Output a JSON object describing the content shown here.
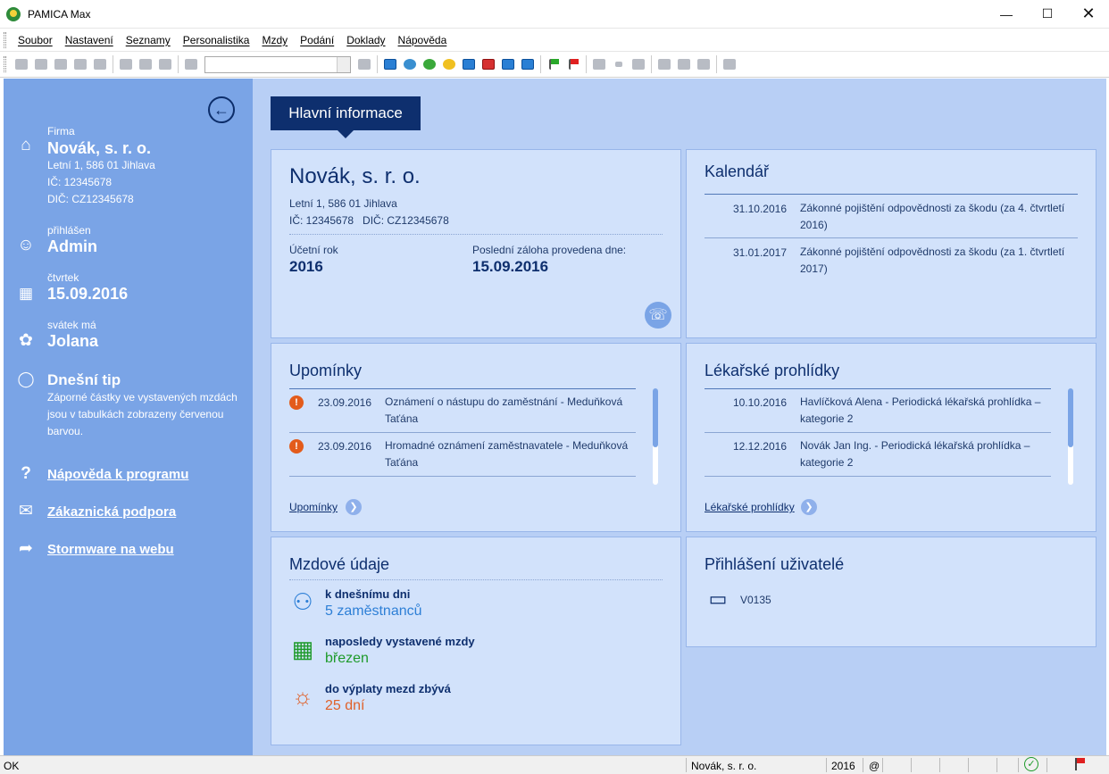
{
  "window": {
    "title": "PAMICA Max"
  },
  "menu": {
    "items": [
      "Soubor",
      "Nastavení",
      "Seznamy",
      "Personalistika",
      "Mzdy",
      "Podání",
      "Doklady",
      "Nápověda"
    ]
  },
  "sidebar": {
    "firma_label": "Firma",
    "firma_name": "Novák, s. r. o.",
    "address": "Letní 1, 586 01 Jihlava",
    "ico": "IČ: 12345678",
    "dic": "DIČ: CZ12345678",
    "user_label": "přihlášen",
    "user": "Admin",
    "day_label": "čtvrtek",
    "date": "15.09.2016",
    "nameday_label": "svátek má",
    "nameday": "Jolana",
    "tip_title": "Dnešní tip",
    "tip_text": "Záporné částky ve vystavených mzdách jsou v tabulkách zobrazeny červenou barvou.",
    "links": [
      "Nápověda k programu",
      "Zákaznická podpora",
      "Stormware na webu"
    ]
  },
  "tab": {
    "label": "Hlavní informace"
  },
  "company": {
    "name": "Novák, s. r. o.",
    "address": "Letní 1, 586 01 Jihlava",
    "ids": "IČ: 12345678   DIČ: CZ12345678",
    "year_label": "Účetní rok",
    "year": "2016",
    "backup_label": "Poslední záloha provedena dne:",
    "backup": "15.09.2016"
  },
  "calendar": {
    "title": "Kalendář",
    "rows": [
      {
        "date": "31.10.2016",
        "text": "Zákonné pojištění odpovědnosti za škodu (za 4. čtvrtletí 2016)"
      },
      {
        "date": "31.01.2017",
        "text": "Zákonné pojištění odpovědnosti za škodu (za 1. čtvrtletí 2017)"
      }
    ]
  },
  "reminders": {
    "title": "Upomínky",
    "rows": [
      {
        "date": "23.09.2016",
        "text": "Oznámení o nástupu do zaměstnání - Meduňková Taťána"
      },
      {
        "date": "23.09.2016",
        "text": "Hromadné oznámení zaměstnavatele - Meduňková Taťána"
      }
    ],
    "link": "Upomínky"
  },
  "medical": {
    "title": "Lékařské prohlídky",
    "rows": [
      {
        "date": "10.10.2016",
        "text": "Havlíčková Alena - Periodická lékařská prohlídka – kategorie 2"
      },
      {
        "date": "12.12.2016",
        "text": "Novák Jan Ing. - Periodická lékařská prohlídka – kategorie 2"
      }
    ],
    "link": "Lékařské prohlídky"
  },
  "payroll": {
    "title": "Mzdové údaje",
    "employees_label": "k dnešnímu dni",
    "employees": "5 zaměstnanců",
    "last_label": "naposledy vystavené mzdy",
    "last": "březen",
    "days_label": "do výplaty mezd zbývá",
    "days": "25 dní"
  },
  "users": {
    "title": "Přihlášení uživatelé",
    "user": "V0135"
  },
  "status": {
    "ok": "OK",
    "company": "Novák, s. r. o.",
    "year": "2016",
    "at": "@"
  },
  "colors": {
    "sidebar": "#7aa4e6",
    "main": "#b8cff5",
    "panel": "#d2e2fb",
    "accent": "#0e2f6e",
    "blue": "#2d7fd6",
    "green": "#1e9a2a",
    "orange": "#e0612a"
  }
}
